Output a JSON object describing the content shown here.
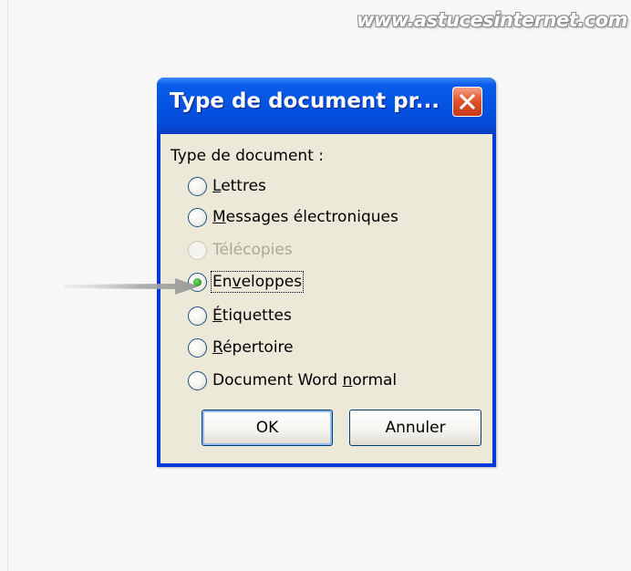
{
  "watermark": "www.astucesinternet.com",
  "dialog": {
    "title": "Type de document pr...",
    "close_icon": "close-x-icon",
    "group_label": "Type de document :",
    "options": [
      {
        "pre": "",
        "ul": "L",
        "post": "ettres",
        "checked": false,
        "disabled": false
      },
      {
        "pre": "",
        "ul": "M",
        "post": "essages électroniques",
        "checked": false,
        "disabled": false
      },
      {
        "pre": "",
        "ul": "",
        "post": "Télécopies",
        "checked": false,
        "disabled": true
      },
      {
        "pre": "En",
        "ul": "v",
        "post": "eloppes",
        "checked": true,
        "disabled": false
      },
      {
        "pre": "",
        "ul": "É",
        "post": "tiquettes",
        "checked": false,
        "disabled": false
      },
      {
        "pre": "",
        "ul": "R",
        "post": "épertoire",
        "checked": false,
        "disabled": false
      },
      {
        "pre": "Document Word ",
        "ul": "n",
        "post": "ormal",
        "checked": false,
        "disabled": false
      }
    ],
    "ok_label": "OK",
    "cancel_label": "Annuler"
  },
  "colors": {
    "titlebar": "#0553e2",
    "dialog_body": "#ece9d8",
    "close_button": "#e2542d",
    "radio_selected": "#21a121"
  },
  "annotation": {
    "arrow_icon": "pointer-arrow-icon",
    "points_to": "Enveloppes"
  }
}
